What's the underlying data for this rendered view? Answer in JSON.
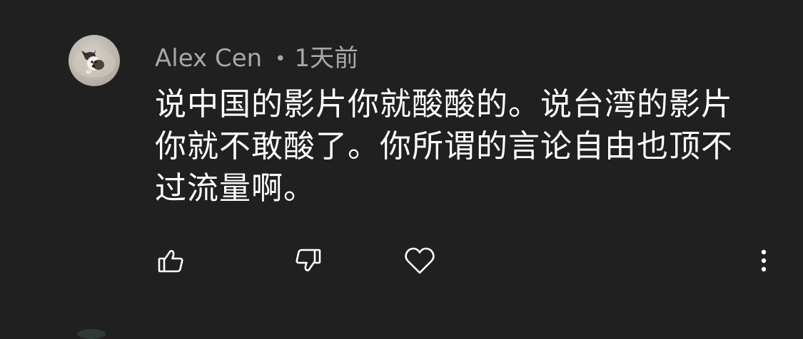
{
  "comment": {
    "author": "Alex Cen",
    "separator": "•",
    "time_ago": "1天前",
    "text": "说中国的影片你就酸酸的。说台湾的影片你就不敢酸了。你所谓的言论自由也顶不过流量啊。",
    "avatar_icon": "dog-photo-avatar"
  },
  "actions": {
    "like_icon": "thumbs-up-icon",
    "dislike_icon": "thumbs-down-icon",
    "heart_icon": "heart-icon",
    "more_icon": "more-vertical-icon"
  },
  "colors": {
    "background": "#202020",
    "primary_text": "#ffffff",
    "secondary_text": "#a8a8a8",
    "icon": "#ffffff"
  }
}
